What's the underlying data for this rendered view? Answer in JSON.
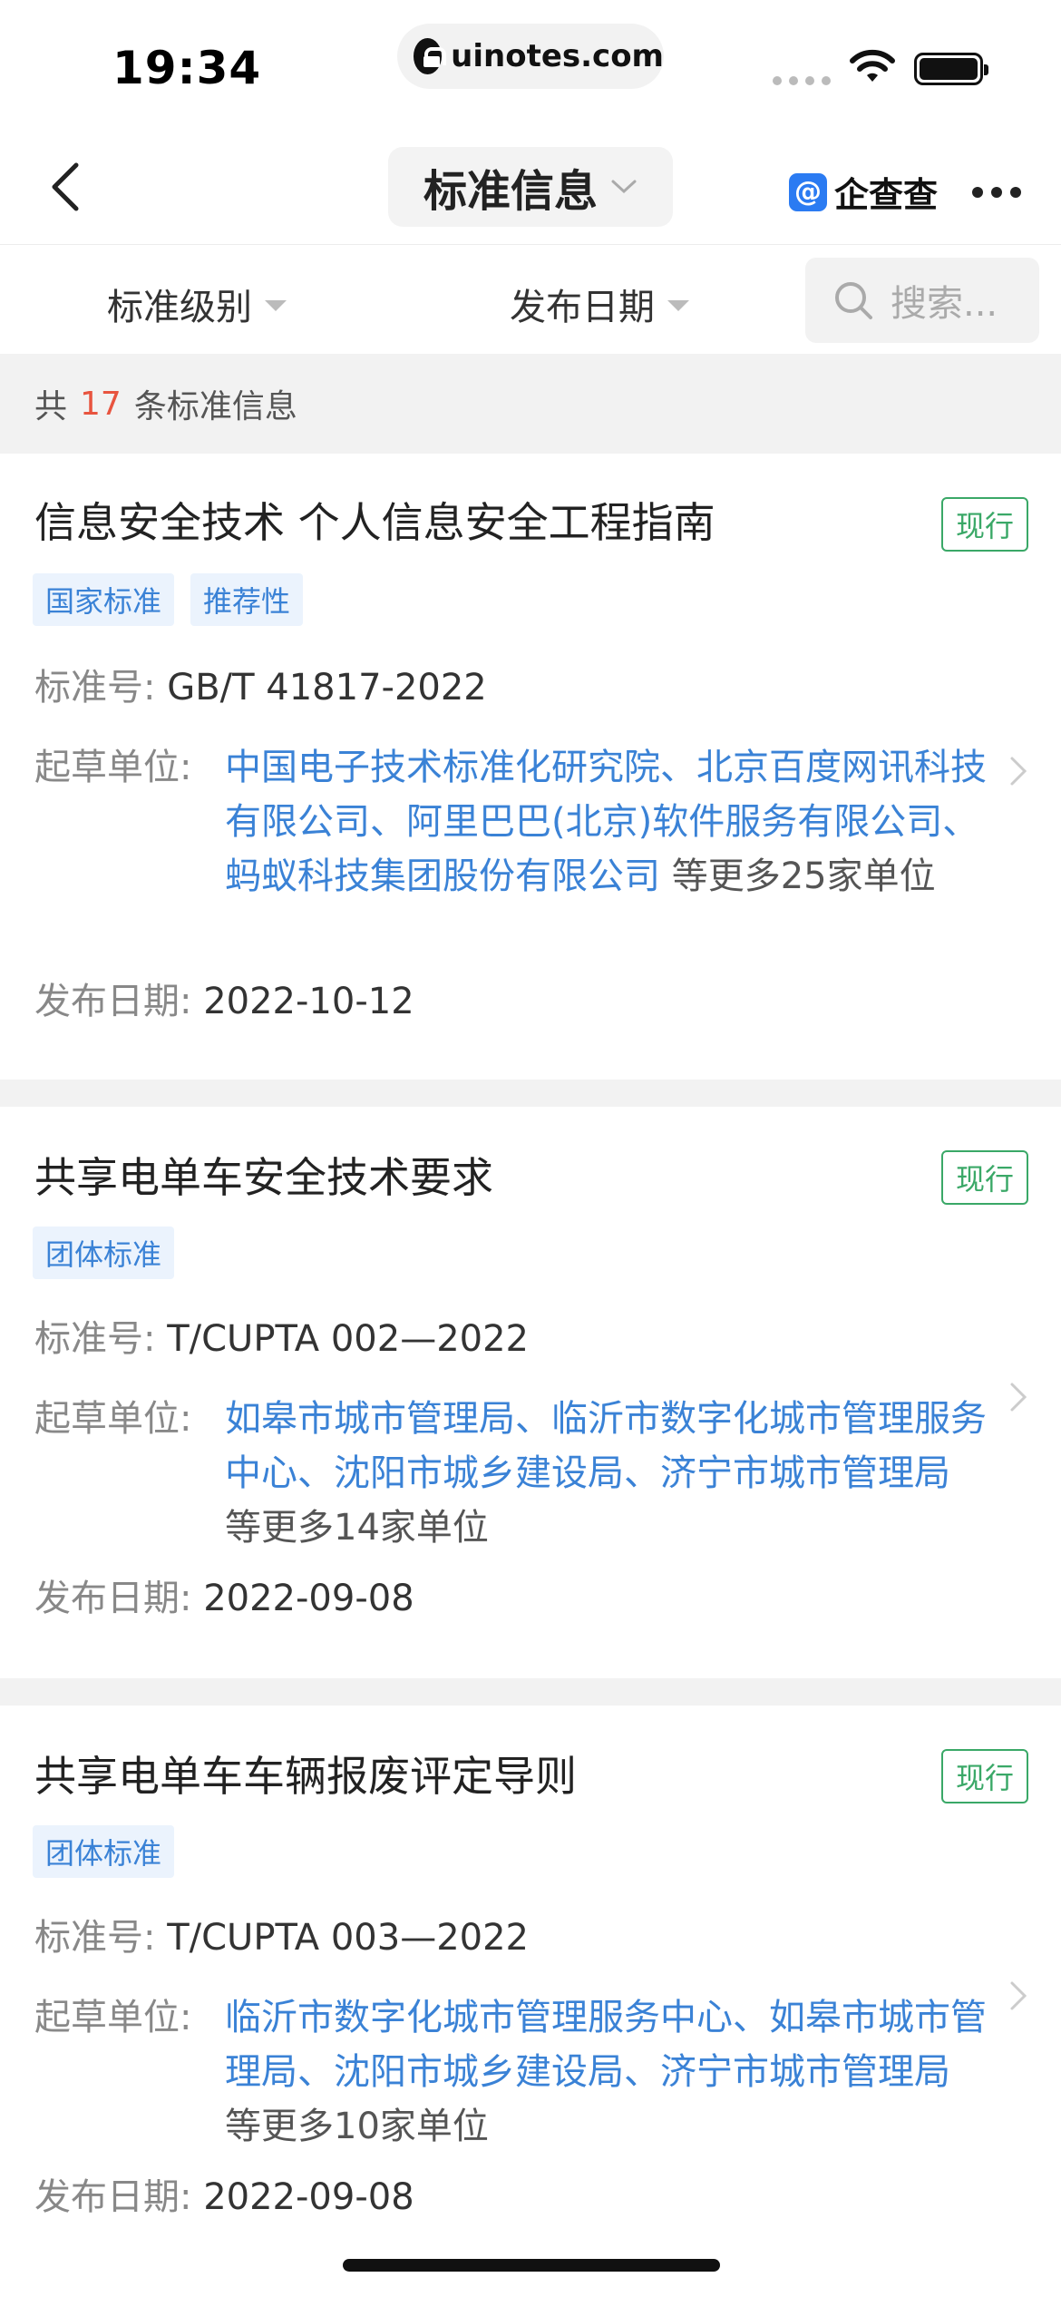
{
  "status_bar": {
    "time": "19:34",
    "url": "uinotes.com"
  },
  "nav": {
    "title": "标准信息",
    "brand": "企查查",
    "brand_icon_letter": "@"
  },
  "filters": {
    "level_label": "标准级别",
    "date_label": "发布日期",
    "search_placeholder": "搜索..."
  },
  "count": {
    "prefix": "共",
    "number": "17",
    "suffix": "条标准信息"
  },
  "labels": {
    "std_no": "标准号:",
    "drafter": "起草单位:",
    "pub_date": "发布日期:"
  },
  "cards": [
    {
      "title": "信息安全技术 个人信息安全工程指南",
      "status": "现行",
      "tags": [
        "国家标准",
        "推荐性"
      ],
      "std_no": "GB/T 41817-2022",
      "drafters": "中国电子技术标准化研究院、北京百度网讯科技有限公司、阿里巴巴(北京)软件服务有限公司、蚂蚁科技集团股份有限公司",
      "drafters_more": "等更多25家单位",
      "pub_date": "2022-10-12"
    },
    {
      "title": "共享电单车安全技术要求",
      "status": "现行",
      "tags": [
        "团体标准"
      ],
      "std_no": "T/CUPTA 002—2022",
      "drafters": "如皋市城市管理局、临沂市数字化城市管理服务中心、沈阳市城乡建设局、济宁市城市管理局",
      "drafters_more": "等更多14家单位",
      "pub_date": "2022-09-08"
    },
    {
      "title": "共享电单车车辆报废评定导则",
      "status": "现行",
      "tags": [
        "团体标准"
      ],
      "std_no": "T/CUPTA 003—2022",
      "drafters": "临沂市数字化城市管理服务中心、如皋市城市管理局、沈阳市城乡建设局、济宁市城市管理局",
      "drafters_more": "等更多10家单位",
      "pub_date": "2022-09-08"
    }
  ],
  "colors": {
    "link": "#3a82d6",
    "status_green": "#3aa867",
    "count_red": "#e8543f",
    "brand_blue": "#2b7bf2"
  }
}
